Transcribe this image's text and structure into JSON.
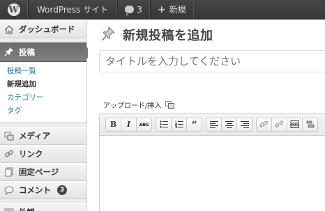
{
  "adminbar": {
    "logo": "W",
    "site_name": "WordPress サイト",
    "comments_count": "3",
    "new_label": "新規",
    "plus_symbol": "+"
  },
  "sidebar": {
    "dashboard": "ダッシュボード",
    "posts": "投稿",
    "submenu": [
      "投稿一覧",
      "新規追加",
      "カテゴリー",
      "タグ"
    ],
    "media": "メディア",
    "links": "リンク",
    "pages": "固定ページ",
    "comments": "コメント",
    "comments_badge": "3",
    "appearance": "外観"
  },
  "main": {
    "page_title": "新規投稿を追加",
    "title_placeholder": "タイトルを入力してください",
    "upload_label": "アップロード/挿入"
  },
  "toolbar": {
    "bold": "B",
    "italic": "I",
    "strikethrough": "ABC",
    "blockquote": "“"
  },
  "icons": {
    "wp_logo": "wordpress-icon",
    "comments": "speech-bubble-icon",
    "new": "plus-icon",
    "dashboard": "home-icon",
    "posts": "pushpin-icon",
    "media": "media-icon",
    "links": "chain-link-icon",
    "pages": "page-icon",
    "comments_menu": "comment-bubble-icon",
    "appearance": "appearance-icon"
  },
  "colors": {
    "adminbar_bg": "#464646",
    "sidebar_bg": "#ececec",
    "current_menu_bg": "#7a7a7a",
    "link": "#21759b",
    "title_text": "#464646"
  }
}
